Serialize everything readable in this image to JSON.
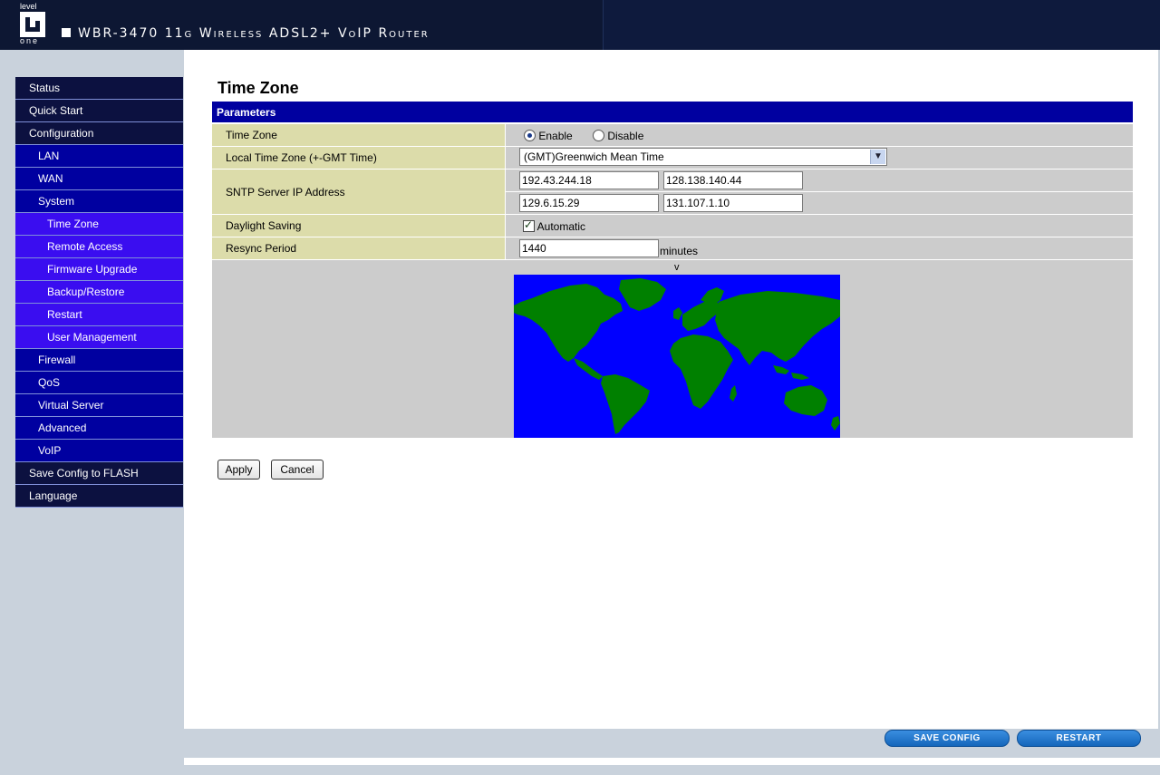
{
  "header": {
    "logo_top": "level",
    "logo_bottom": "one",
    "product": "WBR-3470 11g Wireless ADSL2+ VoIP Router"
  },
  "menu": [
    {
      "label": "Status",
      "level": 0
    },
    {
      "label": "Quick Start",
      "level": 0
    },
    {
      "label": "Configuration",
      "level": 0
    },
    {
      "label": "LAN",
      "level": 1
    },
    {
      "label": "WAN",
      "level": 1
    },
    {
      "label": "System",
      "level": 1
    },
    {
      "label": "Time Zone",
      "level": 2
    },
    {
      "label": "Remote Access",
      "level": 2
    },
    {
      "label": "Firmware Upgrade",
      "level": 2
    },
    {
      "label": "Backup/Restore",
      "level": 2
    },
    {
      "label": "Restart",
      "level": 2
    },
    {
      "label": "User Management",
      "level": 2
    },
    {
      "label": "Firewall",
      "level": 1
    },
    {
      "label": "QoS",
      "level": 1
    },
    {
      "label": "Virtual Server",
      "level": 1
    },
    {
      "label": "Advanced",
      "level": 1
    },
    {
      "label": "VoIP",
      "level": 1
    },
    {
      "label": "Save Config to FLASH",
      "level": 0
    },
    {
      "label": "Language",
      "level": 0
    }
  ],
  "page": {
    "title": "Time Zone",
    "section": "Parameters"
  },
  "form": {
    "time_zone": {
      "label": "Time Zone",
      "enable": "Enable",
      "disable": "Disable",
      "selected": "Enable"
    },
    "local_tz": {
      "label": "Local Time Zone (+-GMT Time)",
      "value": "(GMT)Greenwich Mean Time"
    },
    "sntp": {
      "label": "SNTP Server IP Address",
      "ip1": "192.43.244.18",
      "ip2": "128.138.140.44",
      "ip3": "129.6.15.29",
      "ip4": "131.107.1.10"
    },
    "daylight": {
      "label": "Daylight Saving",
      "option": "Automatic",
      "checked": true
    },
    "resync": {
      "label": "Resync Period",
      "value": "1440",
      "unit": "minutes"
    }
  },
  "map": {
    "marker": "v",
    "ocean_color": "#0000ff",
    "land_color": "#008000"
  },
  "buttons": {
    "apply": "Apply",
    "cancel": "Cancel",
    "save_config": "SAVE CONFIG",
    "restart": "RESTART"
  },
  "colors": {
    "header_bg": "#0d1733",
    "menu_top": "#0c1140",
    "menu_sub": "#0000a0",
    "menu_subsub": "#3a0df0",
    "label_bg": "#dcdcaa",
    "value_bg": "#cccccc"
  }
}
